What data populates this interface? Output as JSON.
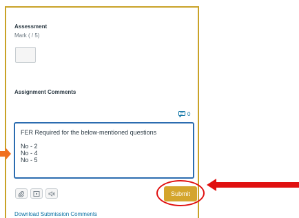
{
  "assessment": {
    "heading": "Assessment",
    "mark_label": "Mark ( / 5)",
    "mark_value": ""
  },
  "comments": {
    "heading": "Assignment Comments",
    "count": "0",
    "text": "FER Required for the below-mentioned questions\n\nNo - 2\nNo - 4\nNo - 5"
  },
  "tools": [
    "paperclip-icon",
    "media-icon",
    "audio-icon"
  ],
  "submit_label": "Submit",
  "download_label": "Download Submission Comments",
  "colors": {
    "accent": "#c9a227",
    "submit": "#d4a52d",
    "highlight_red": "#e01010",
    "link": "#0770a3"
  }
}
